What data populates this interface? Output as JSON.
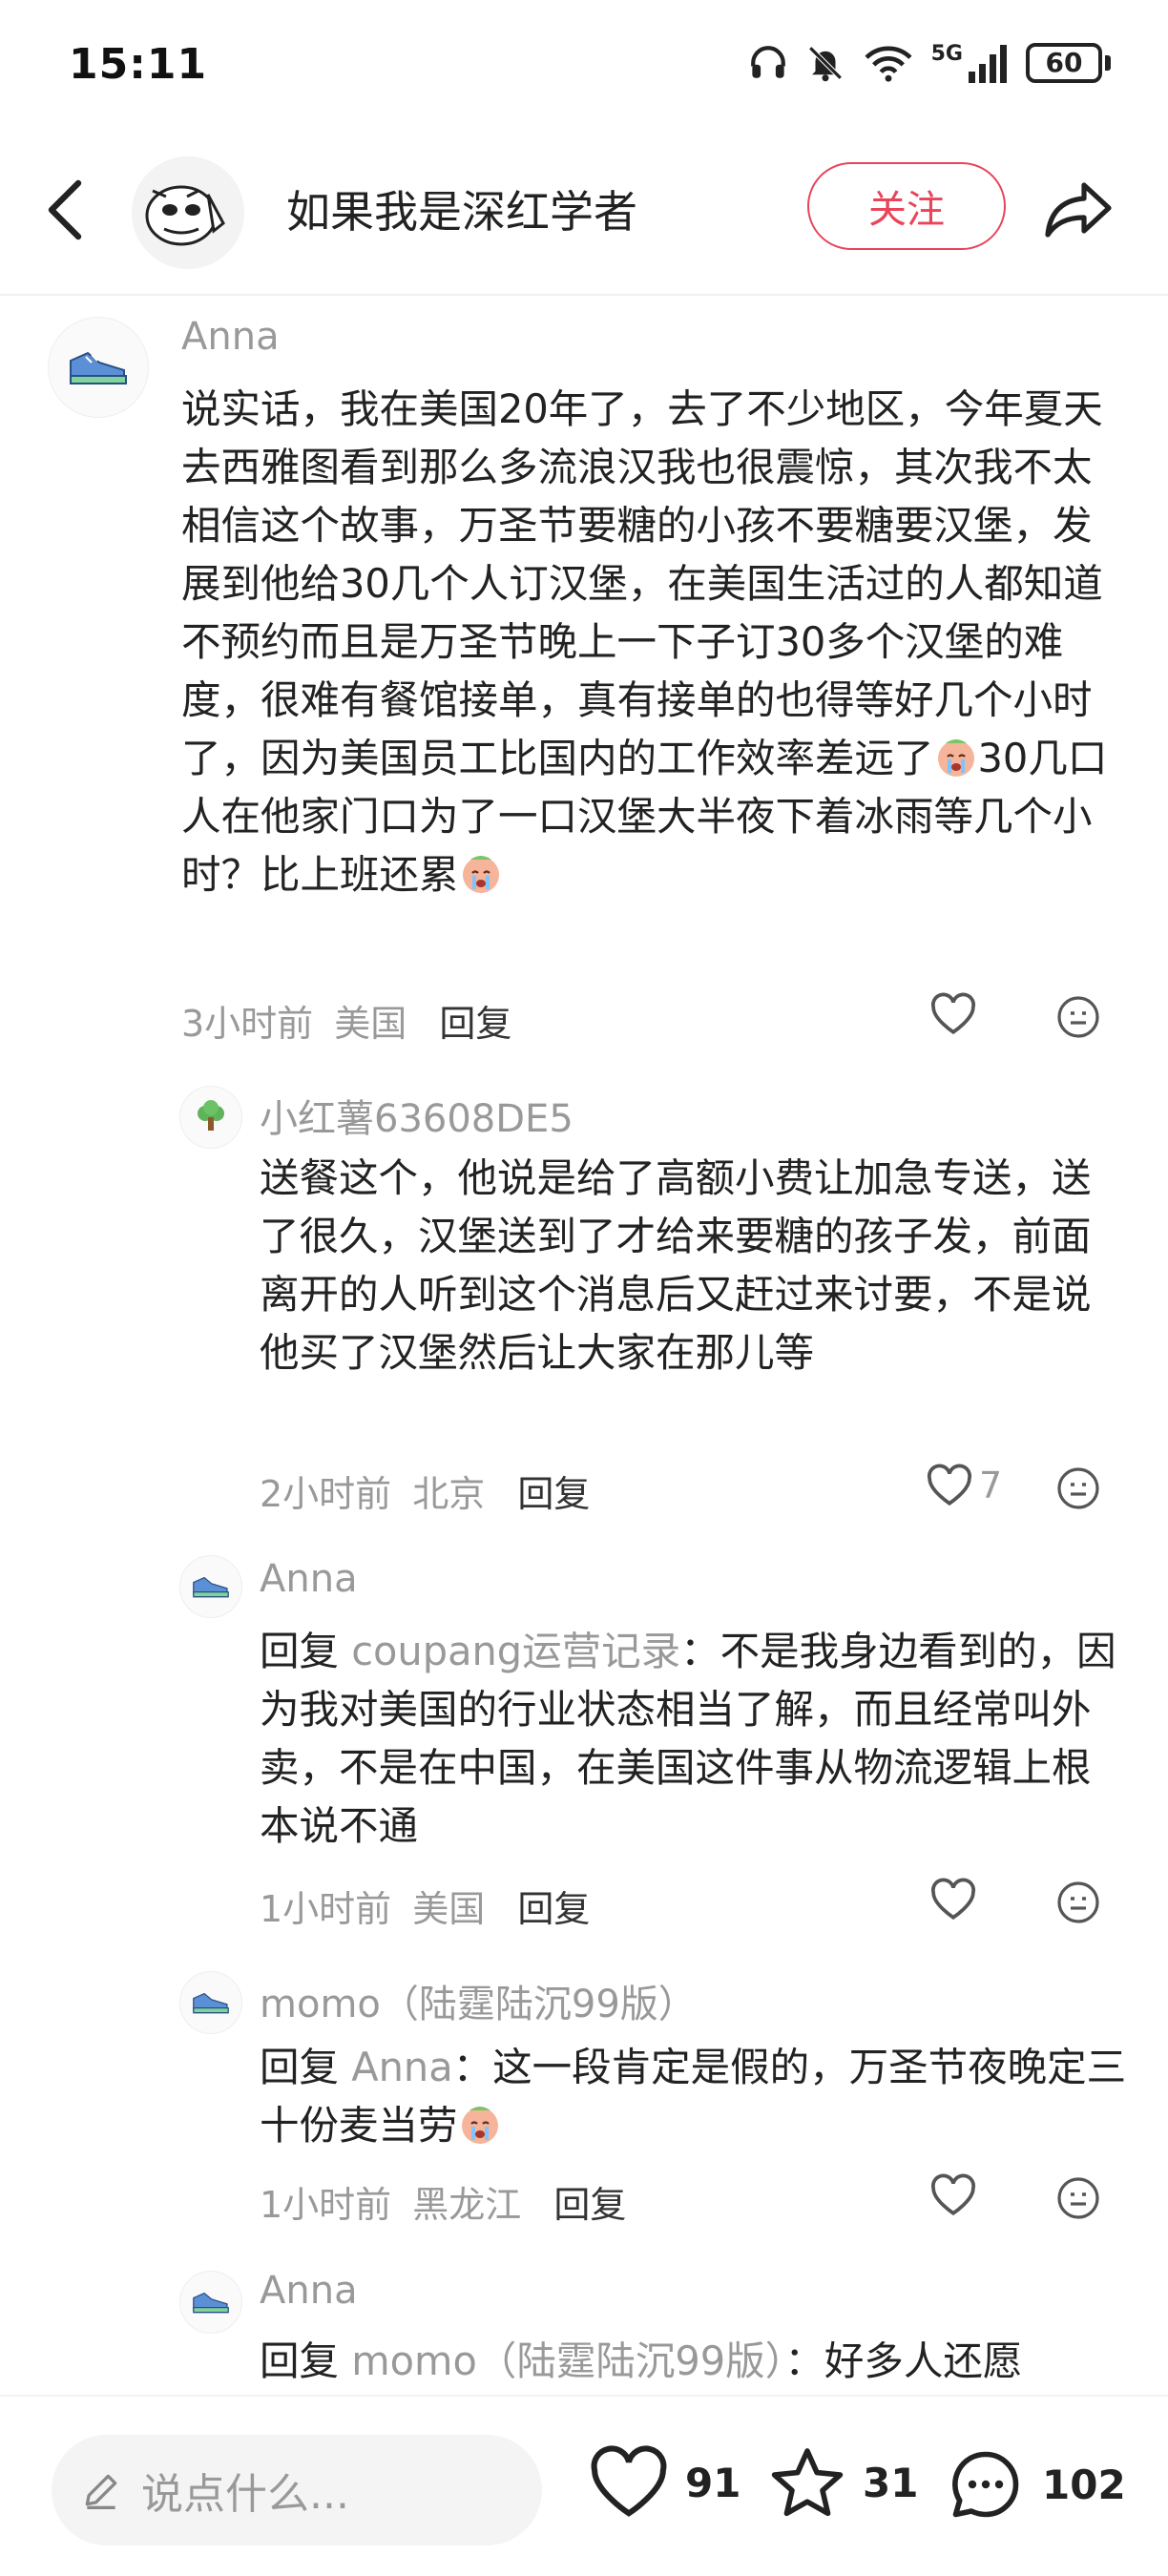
{
  "status_bar": {
    "time": "15:11",
    "battery": "60",
    "network": "5G"
  },
  "header": {
    "author_name": "如果我是深红学者",
    "follow_label": "关注"
  },
  "comments": [
    {
      "user": "Anna",
      "text": "说实话，我在美国20年了，去了不少地区，今年夏天去西雅图看到那么多流浪汉我也很震惊，其次我不太相信这个故事，万圣节要糖的小孩不要糖要汉堡，发展到他给30几个人订汉堡，在美国生活过的人都知道不预约而且是万圣节晚上一下子订30多个汉堡的难度，很难有餐馆接单，真有接单的也得等好几个小时了，因为美国员工比国内的工作效率差远了",
      "text_after_emoji": "30几口人在他家门口为了一口汉堡大半夜下着冰雨等几个小时？比上班还累",
      "time": "3小时前",
      "location": "美国",
      "reply_label": "回复",
      "likes": ""
    },
    {
      "user": "小红薯63608DE5",
      "text": "送餐这个，他说是给了高额小费让加急专送，送了很久，汉堡送到了才给来要糖的孩子发，前面离开的人听到这个消息后又赶过来讨要，不是说他买了汉堡然后让大家在那儿等",
      "time": "2小时前",
      "location": "北京",
      "reply_label": "回复",
      "likes": "7"
    },
    {
      "user": "Anna",
      "reply_prefix": "回复",
      "reply_to": "coupang运营记录",
      "text": "：不是我身边看到的，因为我对美国的行业状态相当了解，而且经常叫外卖，不是在中国，在美国这件事从物流逻辑上根本说不通",
      "time": "1小时前",
      "location": "美国",
      "reply_label": "回复",
      "likes": ""
    },
    {
      "user": "momo（陆霆陆沉99版）",
      "reply_prefix": "回复",
      "reply_to": "Anna",
      "text": "：这一段肯定是假的，万圣节夜晚定三十份麦当劳",
      "time": "1小时前",
      "location": "黑龙江",
      "reply_label": "回复",
      "likes": ""
    },
    {
      "user": "Anna",
      "reply_prefix": "回复",
      "reply_to": "momo（陆霆陆沉99版）",
      "text": "：好多人还愿"
    }
  ],
  "bottom_bar": {
    "input_placeholder": "说点什么...",
    "likes": "91",
    "favorites": "31",
    "comments": "102"
  },
  "icons": {
    "back": "back-arrow-icon",
    "share": "share-icon",
    "like": "heart-icon",
    "emoji": "emoji-icon",
    "favorite": "star-icon",
    "comment": "comment-bubble-icon",
    "edit": "pencil-icon"
  },
  "colors": {
    "accent": "#e8445a",
    "muted": "#999999",
    "text": "#222222"
  }
}
